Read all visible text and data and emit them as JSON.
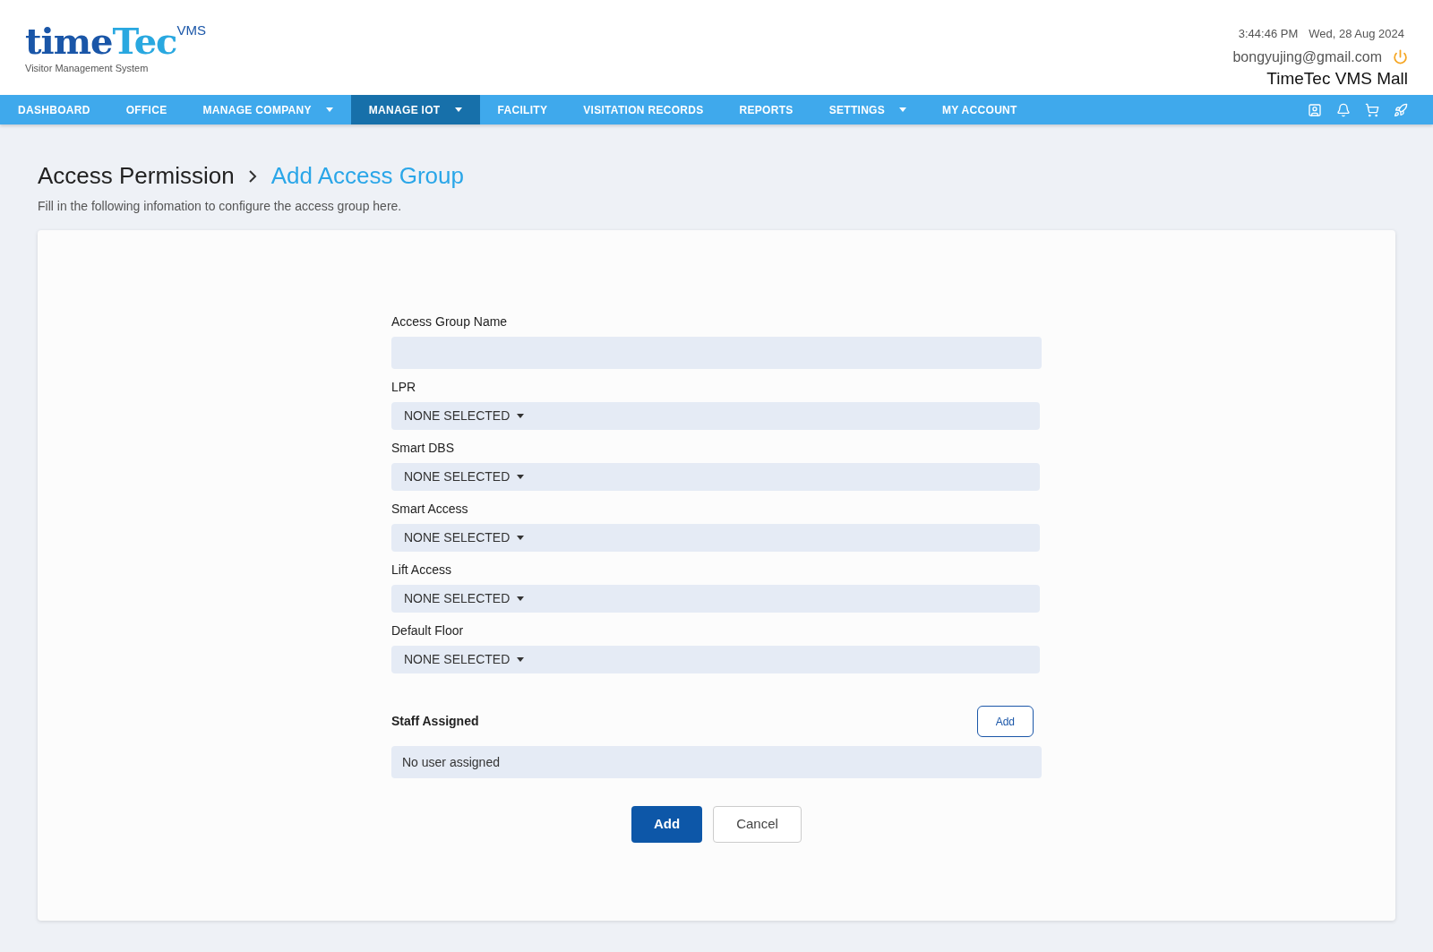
{
  "logo": {
    "brand_dark": "time",
    "brand_light": "Tec",
    "suffix": "VMS",
    "tagline": "Visitor Management System"
  },
  "header": {
    "time": "3:44:46 PM",
    "date": "Wed, 28 Aug 2024",
    "email": "bongyujing@gmail.com",
    "company": "TimeTec VMS Mall"
  },
  "nav": [
    {
      "label": "DASHBOARD",
      "dropdown": false,
      "selected": false
    },
    {
      "label": "OFFICE",
      "dropdown": false,
      "selected": false
    },
    {
      "label": "MANAGE COMPANY",
      "dropdown": true,
      "selected": false
    },
    {
      "label": "MANAGE IOT",
      "dropdown": true,
      "selected": true
    },
    {
      "label": "FACILITY",
      "dropdown": false,
      "selected": false
    },
    {
      "label": "VISITATION RECORDS",
      "dropdown": false,
      "selected": false
    },
    {
      "label": "REPORTS",
      "dropdown": false,
      "selected": false
    },
    {
      "label": "SETTINGS",
      "dropdown": true,
      "selected": false
    },
    {
      "label": "MY ACCOUNT",
      "dropdown": false,
      "selected": false
    }
  ],
  "breadcrumb": {
    "parent": "Access Permission",
    "current": "Add Access Group"
  },
  "subtitle": "Fill in the following infomation to configure the access group here.",
  "fields": [
    {
      "kind": "text",
      "label": "Access Group Name"
    },
    {
      "kind": "select",
      "label": "LPR",
      "value": "NONE SELECTED"
    },
    {
      "kind": "select",
      "label": "Smart DBS",
      "value": "NONE SELECTED"
    },
    {
      "kind": "select",
      "label": "Smart Access",
      "value": "NONE SELECTED"
    },
    {
      "kind": "select",
      "label": "Lift Access",
      "value": "NONE SELECTED"
    },
    {
      "kind": "select",
      "label": "Default Floor",
      "value": "NONE SELECTED"
    }
  ],
  "staff": {
    "title": "Staff Assigned",
    "add_button": "Add",
    "empty_text": "No user assigned"
  },
  "actions": {
    "primary": "Add",
    "secondary": "Cancel"
  }
}
